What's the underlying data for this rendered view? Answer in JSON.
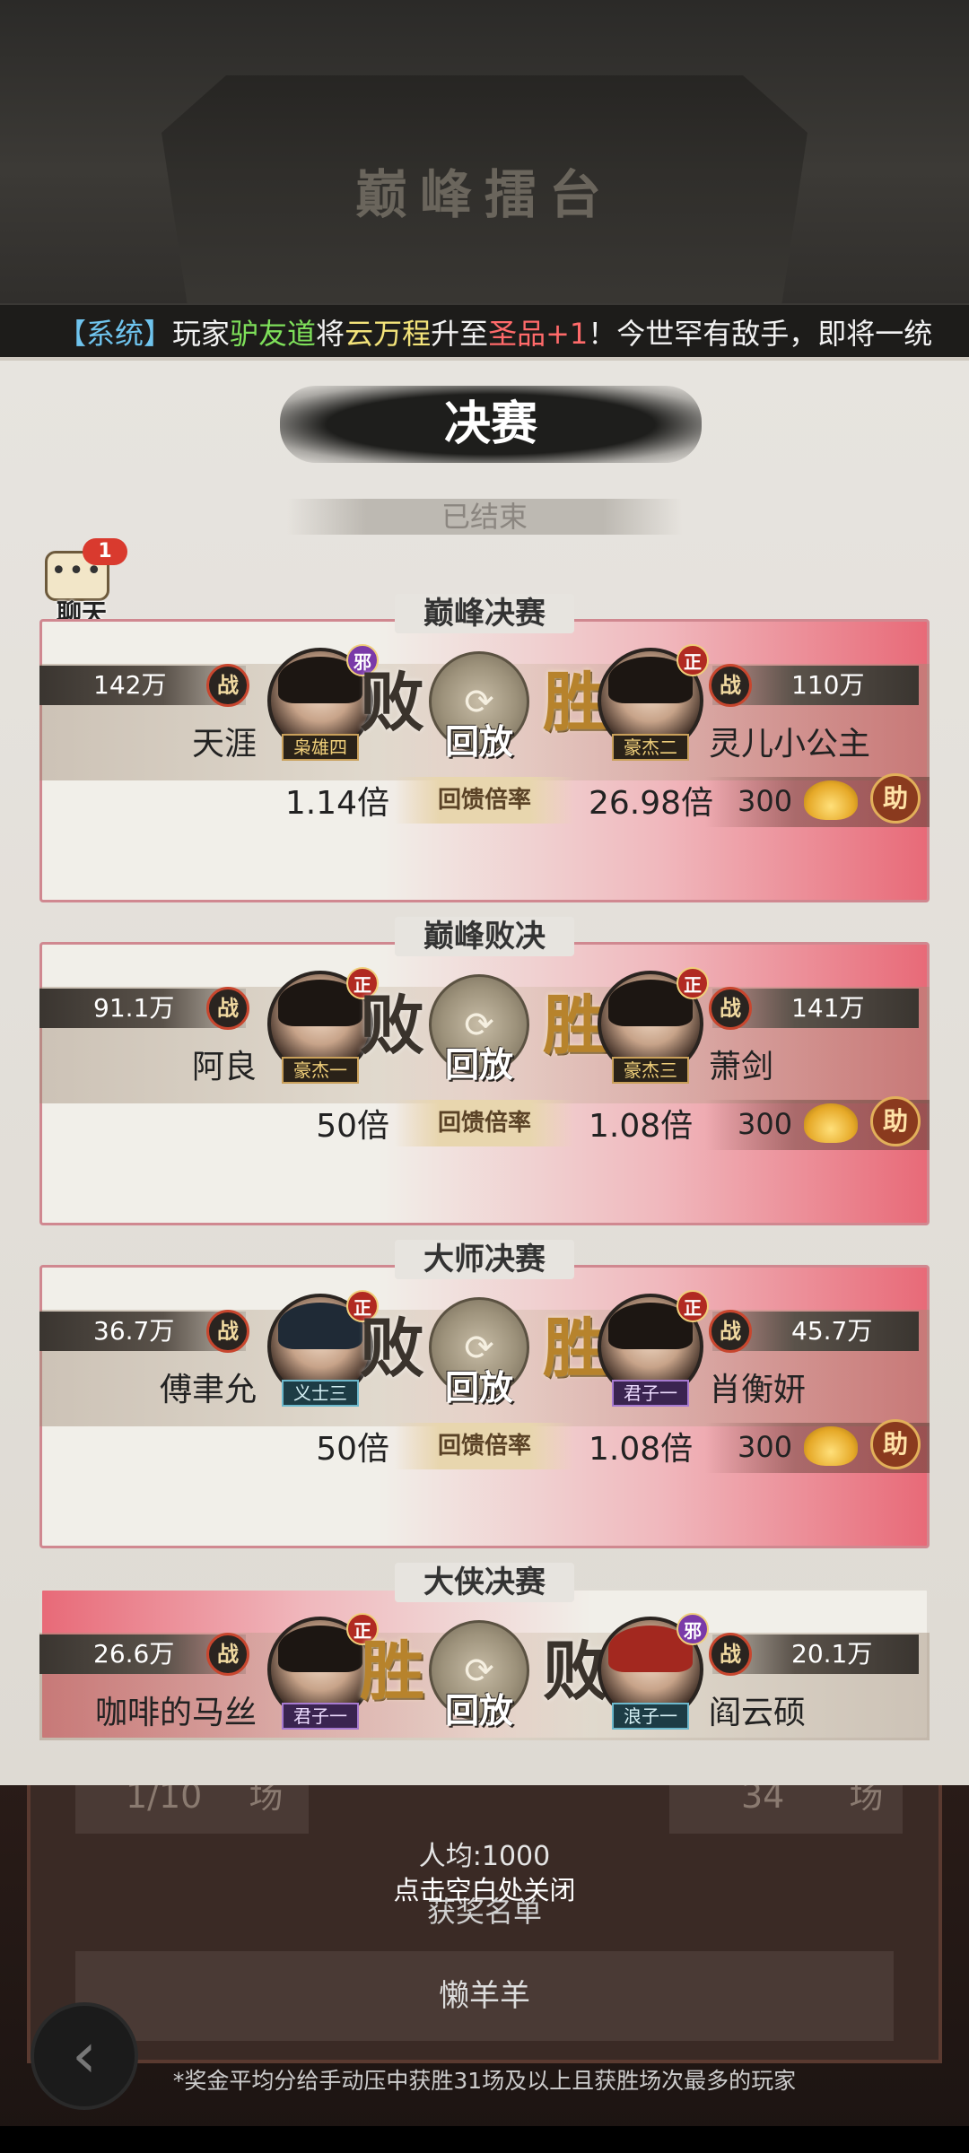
{
  "background": {
    "arena_title": "巅峰擂台",
    "stat_left": {
      "value": "1/10",
      "unit": "场"
    },
    "stat_right": {
      "value": "34",
      "unit": "场"
    },
    "avg_prize": "人均:1000",
    "winners_title": "获奖名单",
    "winner_name": "懒羊羊",
    "footnote": "*奖金平均分给手动压中获胜31场及以上且获胜场次最多的玩家"
  },
  "ticker": {
    "sys_tag": "【系统】",
    "t1": "玩家",
    "player": "驴友道",
    "t2": "将",
    "hero": "云万程",
    "t3": "升至",
    "grade": "圣品+1",
    "t4": "！今世罕有敌手，即将一统"
  },
  "panel": {
    "title": "决赛",
    "status": "已结束",
    "replay_label": "回放",
    "odds_label": "回馈倍率"
  },
  "chat": {
    "label": "聊天",
    "badge": "1",
    "bubble": "•••"
  },
  "matches": [
    {
      "title": "巅峰决赛",
      "left": {
        "name": "天涯",
        "power": "142万",
        "rank": "枭雄四",
        "sect": "邪",
        "result": "败",
        "odds": "1.14倍"
      },
      "right": {
        "name": "灵儿小公主",
        "power": "110万",
        "rank": "豪杰二",
        "sect": "正",
        "result": "胜",
        "odds": "26.98倍"
      },
      "support": "300"
    },
    {
      "title": "巅峰败决",
      "left": {
        "name": "阿良",
        "power": "91.1万",
        "rank": "豪杰一",
        "sect": "正",
        "result": "败",
        "odds": "50倍"
      },
      "right": {
        "name": "萧剑",
        "power": "141万",
        "rank": "豪杰三",
        "sect": "正",
        "result": "胜",
        "odds": "1.08倍"
      },
      "support": "300"
    },
    {
      "title": "大师决赛",
      "left": {
        "name": "傅聿允",
        "power": "36.7万",
        "rank": "义士三",
        "sect": "正",
        "result": "败",
        "odds": "50倍"
      },
      "right": {
        "name": "肖衡妍",
        "power": "45.7万",
        "rank": "君子一",
        "sect": "正",
        "result": "胜",
        "odds": "1.08倍"
      },
      "support": "300"
    },
    {
      "title": "大侠决赛",
      "left": {
        "name": "咖啡的马丝",
        "power": "26.6万",
        "rank": "君子一",
        "sect": "正",
        "result": "胜"
      },
      "right": {
        "name": "阎云硕",
        "power": "20.1万",
        "rank": "浪子一",
        "sect": "邪",
        "result": "败"
      }
    }
  ],
  "zhan_label": "战",
  "zhu_label": "助",
  "close_hint": "点击空白处关闭"
}
